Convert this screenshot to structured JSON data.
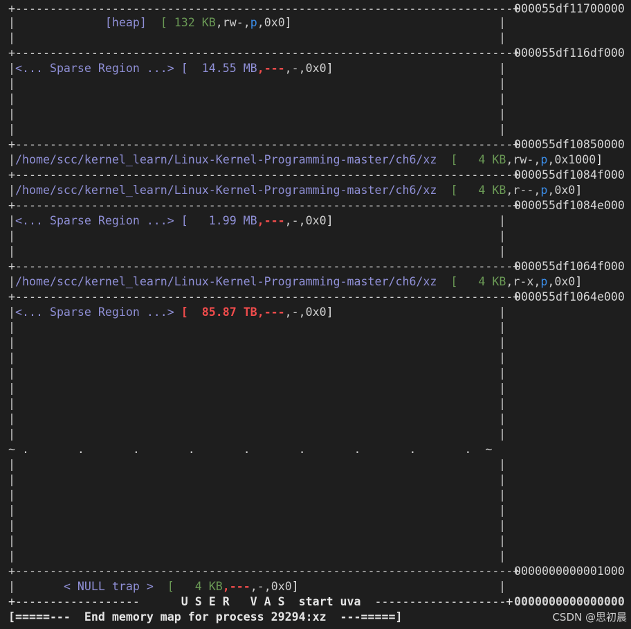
{
  "lines": {
    "sep0": "+------------------------------------------------------------------------+",
    "heap_open": "|             ",
    "heap_label": "[heap]",
    "heap_mid": "  ",
    "heap_bopen": "[ ",
    "heap_size": "132 KB",
    "heap_c1": ",",
    "heap_rw": "rw-",
    "heap_c2": ",",
    "heap_p": "p",
    "heap_c3": ",",
    "heap_off": "0x0",
    "heap_close": "]",
    "heap_pipe": "|",
    "sep1": "+------------------------------------------------------------------------+",
    "s1_pipe": "|",
    "s1_label": "<... Sparse Region ...>",
    "s1_bopen": " [  ",
    "s1_size": "14.55 MB",
    "s1_c1": ",",
    "s1_perm": "---",
    "s1_c2": ",",
    "s1_dash": "-",
    "s1_c3": ",",
    "s1_off": "0x0",
    "s1_close": "]",
    "bar": "|",
    "bar_right": "|",
    "sep2": "+------------------------------------------------------------------------+",
    "f1_pipe": "|",
    "f1_path": "/home/scc/kernel_learn/Linux-Kernel-Programming-master/ch6/xz",
    "f1_bopen": "  [   ",
    "f1_size": "4 KB",
    "f1_c1": ",",
    "f1_perm": "rw-",
    "f1_c2": ",",
    "f1_p": "p",
    "f1_c3": ",",
    "f1_off": "0x1000",
    "f1_close": "]",
    "sep3": "+------------------------------------------------------------------------+",
    "f2_pipe": "|",
    "f2_path": "/home/scc/kernel_learn/Linux-Kernel-Programming-master/ch6/xz",
    "f2_bopen": "  [   ",
    "f2_size": "4 KB",
    "f2_c1": ",",
    "f2_perm": "r--",
    "f2_c2": ",",
    "f2_p": "p",
    "f2_c3": ",",
    "f2_off": "0x0",
    "f2_close": "]",
    "sep4": "+------------------------------------------------------------------------+",
    "s2_pipe": "|",
    "s2_label": "<... Sparse Region ...>",
    "s2_bopen": " [   ",
    "s2_size": "1.99 MB",
    "s2_c1": ",",
    "s2_perm": "---",
    "s2_c2": ",",
    "s2_dash": "-",
    "s2_c3": ",",
    "s2_off": "0x0",
    "s2_close": "]",
    "sep5": "+------------------------------------------------------------------------+",
    "f3_pipe": "|",
    "f3_path": "/home/scc/kernel_learn/Linux-Kernel-Programming-master/ch6/xz",
    "f3_bopen": "  [   ",
    "f3_size": "4 KB",
    "f3_c1": ",",
    "f3_perm": "r-x",
    "f3_c2": ",",
    "f3_p": "p",
    "f3_c3": ",",
    "f3_off": "0x0",
    "f3_close": "]",
    "sep6": "+------------------------------------------------------------------------+",
    "s3_pipe": "|",
    "s3_label": "<... Sparse Region ...>",
    "s3_bopen": " [  ",
    "s3_size": "85.87 TB",
    "s3_c1": ",",
    "s3_perm": "---",
    "s3_c2": ",",
    "s3_dash": "-",
    "s3_c3": ",",
    "s3_off": "0x0",
    "s3_close": "]",
    "dots": "~ .       .       .       .       .       .       .       .       .  ~",
    "sep7": "+------------------------------------------------------------------------+",
    "null_pipe": "|       ",
    "null_label": "< NULL trap >",
    "null_bopen": "  [   ",
    "null_size": "4 KB",
    "null_c1": ",",
    "null_perm": "---",
    "null_c2": ",",
    "null_dash": "-",
    "null_c3": ",",
    "null_off": "0x0",
    "null_close": "]",
    "null_pipe_r": "|",
    "vas_l": "+------------------      ",
    "vas_label": "U S E R   V A S",
    "vas_mid": "  start uva  ",
    "vas_r": "-------------------+",
    "end_open": "[=====---  ",
    "end_text": "End memory map for process 29294:xz",
    "end_close": "  ---=====]"
  },
  "addresses": {
    "a0": "000055df11700000",
    "a1": "000055df116df000",
    "a2": "000055df10850000",
    "a3": "000055df1084f000",
    "a4": "000055df1084e000",
    "a5": "000055df1064f000",
    "a6": "000055df1064e000",
    "a7": "0000000000001000",
    "a8": "0000000000000000"
  },
  "watermark": "CSDN @思初晨",
  "colors": {
    "background": "#1e1e1e",
    "region": "#8f8fd6",
    "size": "#6a9955",
    "perm_p": "#3b8eea",
    "none_perm": "#f14c4c"
  }
}
